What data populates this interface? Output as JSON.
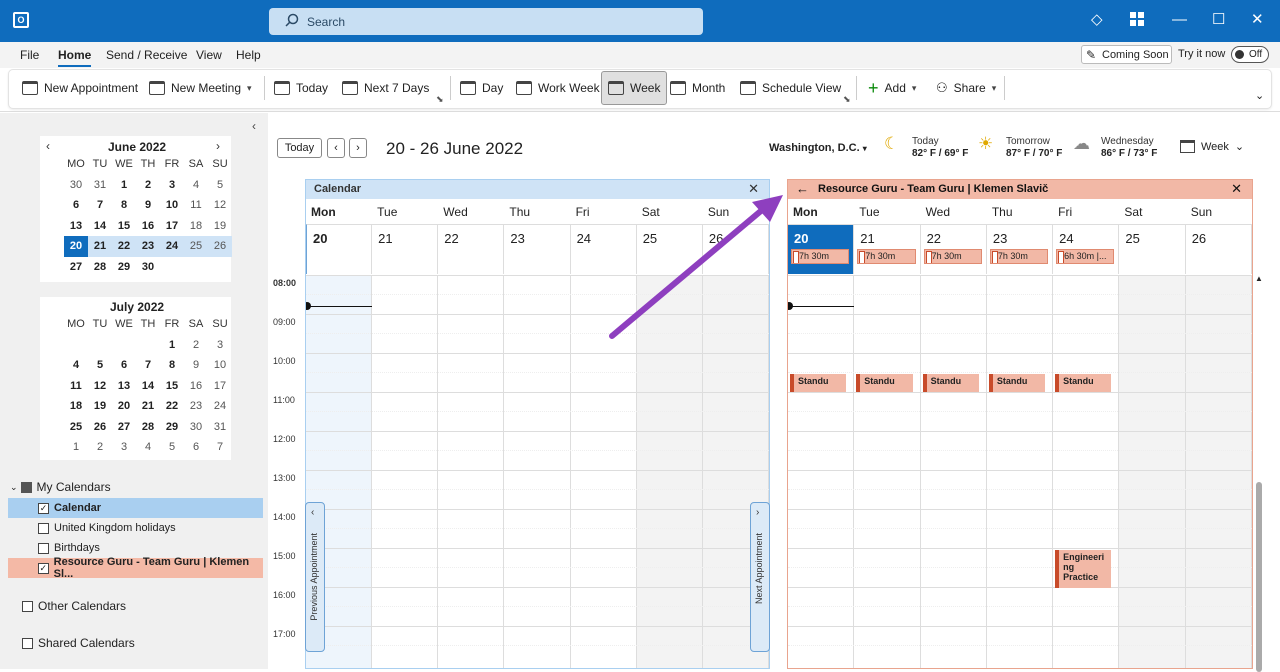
{
  "app": {
    "search_placeholder": "Search"
  },
  "menu": [
    "File",
    "Home",
    "Send / Receive",
    "View",
    "Help"
  ],
  "coming_soon": "Coming Soon",
  "try_it_now": "Try it now",
  "toggle_state": "Off",
  "ribbon": {
    "new_appointment": "New Appointment",
    "new_meeting": "New Meeting",
    "today": "Today",
    "next7": "Next 7 Days",
    "day": "Day",
    "work_week": "Work Week",
    "week": "Week",
    "month": "Month",
    "schedule_view": "Schedule View",
    "add": "Add",
    "share": "Share"
  },
  "minical": {
    "weekdays": [
      "MO",
      "TU",
      "WE",
      "TH",
      "FR",
      "SA",
      "SU"
    ],
    "june": {
      "title": "June 2022",
      "rows": [
        [
          "30",
          "31",
          "1",
          "2",
          "3",
          "4",
          "5"
        ],
        [
          "6",
          "7",
          "8",
          "9",
          "10",
          "11",
          "12"
        ],
        [
          "13",
          "14",
          "15",
          "16",
          "17",
          "18",
          "19"
        ],
        [
          "20",
          "21",
          "22",
          "23",
          "24",
          "25",
          "26"
        ],
        [
          "27",
          "28",
          "29",
          "30",
          "",
          "",
          ""
        ]
      ]
    },
    "july": {
      "title": "July 2022",
      "rows": [
        [
          "",
          "",
          "",
          "",
          "1",
          "2",
          "3"
        ],
        [
          "4",
          "5",
          "6",
          "7",
          "8",
          "9",
          "10"
        ],
        [
          "11",
          "12",
          "13",
          "14",
          "15",
          "16",
          "17"
        ],
        [
          "18",
          "19",
          "20",
          "21",
          "22",
          "23",
          "24"
        ],
        [
          "25",
          "26",
          "27",
          "28",
          "29",
          "30",
          "31"
        ],
        [
          "1",
          "2",
          "3",
          "4",
          "5",
          "6",
          "7"
        ]
      ]
    }
  },
  "calendars": {
    "my": "My Calendars",
    "calendar": "Calendar",
    "uk": "United Kingdom holidays",
    "birthdays": "Birthdays",
    "rg": "Resource Guru - Team Guru | Klemen Sl...",
    "other": "Other Calendars",
    "shared": "Shared Calendars"
  },
  "nav": {
    "today": "Today",
    "range": "20 - 26 June 2022"
  },
  "weather": {
    "location": "Washington, D.C.",
    "today_label": "Today",
    "today_temp": "82° F / 69° F",
    "tomorrow_label": "Tomorrow",
    "tomorrow_temp": "87° F / 70° F",
    "wednesday_label": "Wednesday",
    "wednesday_temp": "86° F / 73° F",
    "view": "Week"
  },
  "panel_left": {
    "title": "Calendar",
    "days": [
      "Mon",
      "Tue",
      "Wed",
      "Thu",
      "Fri",
      "Sat",
      "Sun"
    ],
    "dates": [
      "20",
      "21",
      "22",
      "23",
      "24",
      "25",
      "26"
    ]
  },
  "panel_right": {
    "title": "Resource Guru - Team Guru | Klemen Slavič",
    "days": [
      "Mon",
      "Tue",
      "Wed",
      "Thu",
      "Fri",
      "Sat",
      "Sun"
    ],
    "dates": [
      "20",
      "21",
      "22",
      "23",
      "24",
      "25",
      "26"
    ]
  },
  "allday_events": [
    "7h 30m",
    "7h 30m",
    "7h 30m",
    "7h 30m",
    "6h 30m |..."
  ],
  "events": {
    "standup": "Standu",
    "engineering": "Engineeri ng Practice"
  },
  "times": [
    "08:00",
    "09:00",
    "10:00",
    "11:00",
    "12:00",
    "13:00",
    "14:00",
    "15:00",
    "16:00",
    "17:00"
  ],
  "prev_appt": "Previous Appointment",
  "next_appt": "Next Appointment",
  "colors": {
    "accent": "#0f6cbd",
    "resource": "#f2b8a6",
    "arrow": "#8e3fbf"
  }
}
